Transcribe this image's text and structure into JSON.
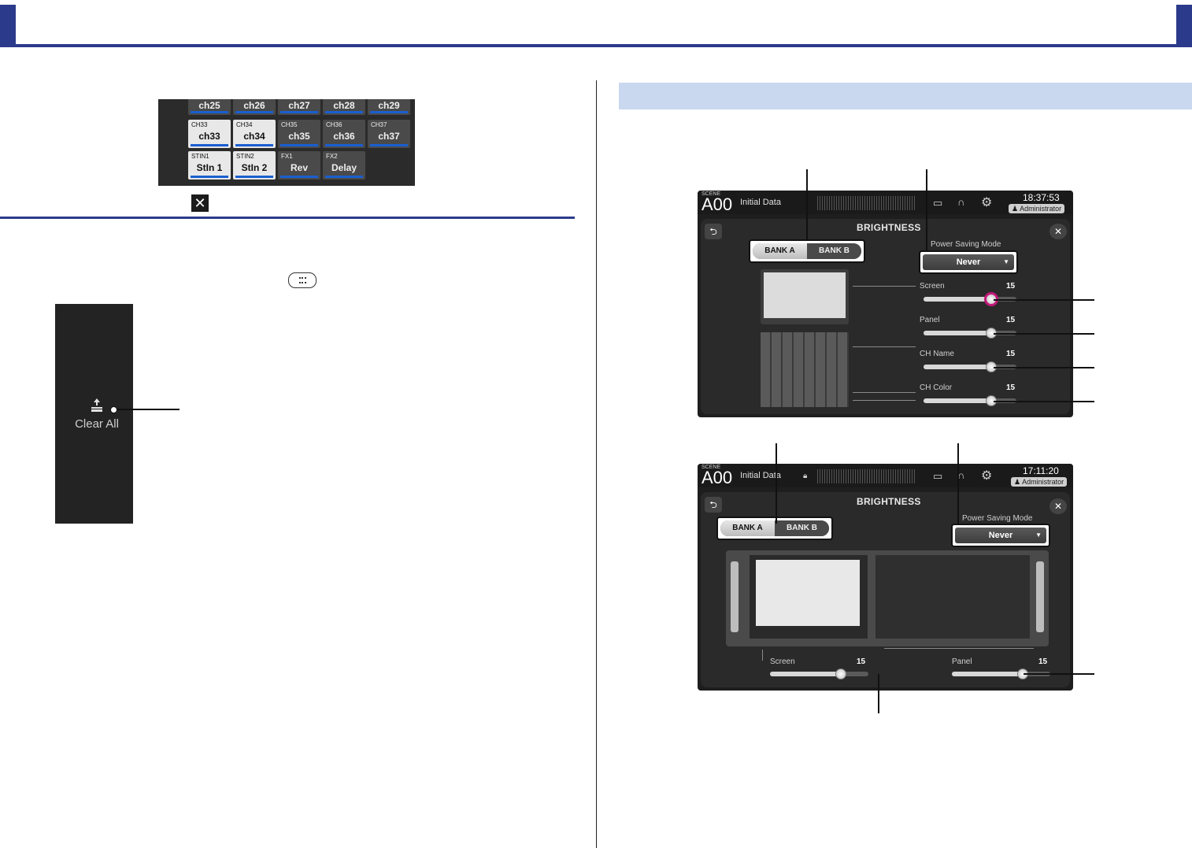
{
  "left": {
    "channel_grid": {
      "rows": [
        [
          {
            "sub": "",
            "main": "ch25"
          },
          {
            "sub": "",
            "main": "ch26"
          },
          {
            "sub": "",
            "main": "ch27"
          },
          {
            "sub": "",
            "main": "ch28"
          },
          {
            "sub": "",
            "main": "ch29"
          }
        ],
        [
          {
            "sub": "CH33",
            "main": "ch33"
          },
          {
            "sub": "CH34",
            "main": "ch34"
          },
          {
            "sub": "CH35",
            "main": "ch35"
          },
          {
            "sub": "CH36",
            "main": "ch36"
          },
          {
            "sub": "CH37",
            "main": "ch37"
          }
        ],
        [
          {
            "sub": "STIN1",
            "main": "StIn 1"
          },
          {
            "sub": "STIN2",
            "main": "StIn 2"
          },
          {
            "sub": "FX1",
            "main": "Rev"
          },
          {
            "sub": "FX2",
            "main": "Delay"
          }
        ]
      ]
    },
    "close_glyph": "✕",
    "clear_all_label": "Clear All"
  },
  "screen1": {
    "scene_label": "SCENE",
    "scene_number": "A00",
    "scene_name": "Initial Data",
    "time": "18:37:53",
    "user": "Administrator",
    "title": "BRIGHTNESS",
    "back_glyph": "⮌",
    "close_glyph": "✕",
    "bank_a": "BANK A",
    "bank_b": "BANK B",
    "power_saving_label": "Power Saving Mode",
    "power_saving_value": "Never",
    "sliders": [
      {
        "label": "Screen",
        "value": "15",
        "level": 0.73
      },
      {
        "label": "Panel",
        "value": "15",
        "level": 0.73
      },
      {
        "label": "CH Name",
        "value": "15",
        "level": 0.73
      },
      {
        "label": "CH Color",
        "value": "15",
        "level": 0.73
      }
    ]
  },
  "screen2": {
    "scene_label": "SCENE",
    "scene_number": "A00",
    "scene_name": "Initial Data",
    "time": "17:11:20",
    "user": "Administrator",
    "title": "BRIGHTNESS",
    "back_glyph": "⮌",
    "close_glyph": "✕",
    "bank_a": "BANK A",
    "bank_b": "BANK B",
    "power_saving_label": "Power Saving Mode",
    "power_saving_value": "Never",
    "sliders": [
      {
        "label": "Screen",
        "value": "15",
        "level": 0.72
      },
      {
        "label": "Panel",
        "value": "15",
        "level": 0.72
      }
    ]
  },
  "icons": [
    "menu-icon",
    "clear-all-icon",
    "tape-icon",
    "headphones-icon",
    "gear-icon",
    "user-icon",
    "lock-icon"
  ],
  "colors": {
    "header": "#2c3a8c",
    "section": "#c9d7ef",
    "selected_knob": "#c2187a",
    "channel_bar": "#1a5fd0"
  }
}
